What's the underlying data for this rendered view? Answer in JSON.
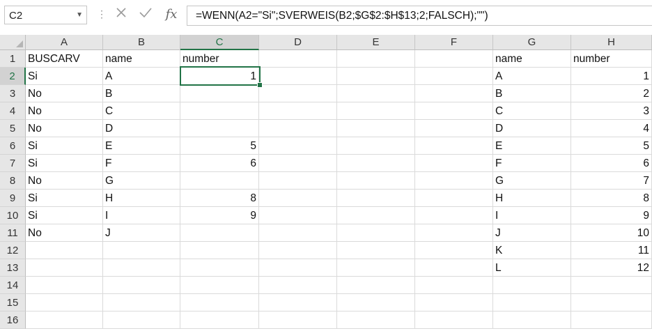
{
  "name_box": {
    "value": "C2",
    "dropdown_icon": "chevron-down-icon"
  },
  "formula_bar": {
    "cancel_icon": "close-icon",
    "enter_icon": "check-icon",
    "function_icon": "fx-icon",
    "function_label": "fx",
    "formula": "=WENN(A2=\"Si\";SVERWEIS(B2;$G$2:$H$13;2;FALSCH);\"\")"
  },
  "accent_color": "#217346",
  "active_cell": "C2",
  "columns": [
    "A",
    "B",
    "C",
    "D",
    "E",
    "F",
    "G",
    "H"
  ],
  "rows": [
    "1",
    "2",
    "3",
    "4",
    "5",
    "6",
    "7",
    "8",
    "9",
    "10",
    "11",
    "12",
    "13",
    "14",
    "15",
    "16"
  ],
  "cells": {
    "A1": "BUSCARV",
    "B1": "name",
    "C1": "number",
    "G1": "name",
    "H1": "number",
    "A2": "Si",
    "B2": "A",
    "C2": "1",
    "G2": "A",
    "H2": "1",
    "A3": "No",
    "B3": "B",
    "G3": "B",
    "H3": "2",
    "A4": "No",
    "B4": "C",
    "G4": "C",
    "H4": "3",
    "A5": "No",
    "B5": "D",
    "G5": "D",
    "H5": "4",
    "A6": "Si",
    "B6": "E",
    "C6": "5",
    "G6": "E",
    "H6": "5",
    "A7": "Si",
    "B7": "F",
    "C7": "6",
    "G7": "F",
    "H7": "6",
    "A8": "No",
    "B8": "G",
    "G8": "G",
    "H8": "7",
    "A9": "Si",
    "B9": "H",
    "C9": "8",
    "G9": "H",
    "H9": "8",
    "A10": "Si",
    "B10": "I",
    "C10": "9",
    "G10": "I",
    "H10": "9",
    "A11": "No",
    "B11": "J",
    "G11": "J",
    "H11": "10",
    "G12": "K",
    "H12": "11",
    "G13": "L",
    "H13": "12"
  },
  "numeric_cells": [
    "C2",
    "C6",
    "C7",
    "C9",
    "C10",
    "H2",
    "H3",
    "H4",
    "H5",
    "H6",
    "H7",
    "H8",
    "H9",
    "H10",
    "H11",
    "H12",
    "H13"
  ]
}
